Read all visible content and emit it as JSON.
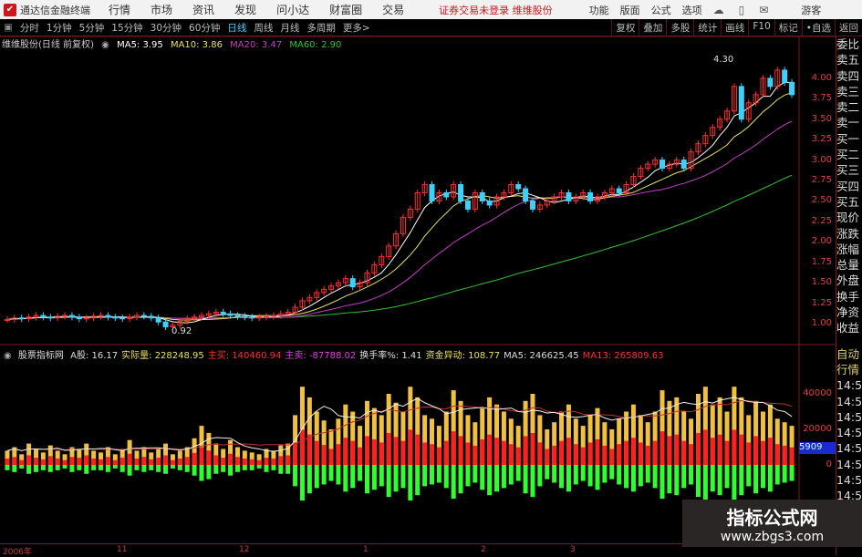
{
  "app": {
    "title": "通达信金融终端",
    "menus": [
      "行情",
      "市场",
      "资讯",
      "发现",
      "问小达",
      "财富圈",
      "交易"
    ],
    "login_status": "证券交易未登录",
    "stock_tag": "维维股份",
    "top_menus": [
      "功能",
      "版面",
      "公式",
      "选项"
    ],
    "user": "游客",
    "icons": [
      "cloud-icon",
      "phone-icon",
      "message-icon"
    ]
  },
  "periods": {
    "items": [
      "分时",
      "1分钟",
      "5分钟",
      "15分钟",
      "30分钟",
      "60分钟",
      "日线",
      "周线",
      "月线",
      "多周期",
      "更多>"
    ],
    "active": "日线"
  },
  "tools": [
    "复权",
    "叠加",
    "多股",
    "统计",
    "画线",
    "F10",
    "标记",
    "•自选",
    "返回"
  ],
  "info": {
    "name": "维维股份(日线 前复权)",
    "ma5": "MA5: 3.95",
    "ma10": "MA10: 3.86",
    "ma20": "MA20: 3.47",
    "ma60": "MA60: 2.90"
  },
  "price_axis": {
    "ticks": [
      "4.00",
      "3.75",
      "3.50",
      "3.25",
      "3.00",
      "2.75",
      "2.50",
      "2.25",
      "2.00",
      "1.75",
      "1.50",
      "1.25",
      "1.00"
    ],
    "high_label": "4.30",
    "low_label": "0.92"
  },
  "indicator": {
    "name": "股票指标网",
    "items": [
      {
        "t": "A股: 16.17",
        "c": "#ddd"
      },
      {
        "t": "实际量: 228248.95",
        "c": "#e8e060"
      },
      {
        "t": "主买: 140460.94",
        "c": "#ff3030"
      },
      {
        "t": "主卖: -87788.02",
        "c": "#e040e0"
      },
      {
        "t": "换手率%: 1.41",
        "c": "#ddd"
      },
      {
        "t": "资金异动: 108.77",
        "c": "#e8e060"
      },
      {
        "t": "MA5: 246625.45",
        "c": "#ddd"
      },
      {
        "t": "MA13: 265809.63",
        "c": "#ff3030"
      }
    ],
    "ticks": [
      "40000",
      "20000",
      "0"
    ],
    "current": "5909"
  },
  "right_panel": {
    "quote_labels": [
      "委比",
      "卖五",
      "卖四",
      "卖三",
      "卖二",
      "卖一",
      "买一",
      "买二",
      "买三",
      "买四",
      "买五",
      "现价",
      "涨跌",
      "涨幅",
      "总量",
      "外盘",
      "换手",
      "净资",
      "收益"
    ],
    "tick_header": [
      "自动",
      "行情"
    ],
    "tick_times": [
      "14:5",
      "14:5",
      "14:5",
      "14:5",
      "14:5",
      "14:5",
      "14:5",
      "14:5"
    ]
  },
  "time_axis": [
    "2006年",
    "11",
    "12",
    "1",
    "2",
    "3"
  ],
  "watermark": {
    "title": "指标公式网",
    "url": "www.zbgs3.com"
  },
  "colors": {
    "up": "#ff3030",
    "down": "#40d0ff",
    "ma5": "#ffffff",
    "ma10": "#e8e060",
    "ma20": "#c040c0",
    "ma60": "#30c030",
    "vol": "#f0c040",
    "buy": "#ff2020",
    "sell": "#30ff30"
  },
  "chart_data": {
    "type": "candlestick",
    "closes": [
      1.05,
      1.07,
      1.06,
      1.08,
      1.1,
      1.08,
      1.07,
      1.09,
      1.1,
      1.08,
      1.06,
      1.07,
      1.09,
      1.1,
      1.08,
      1.07,
      1.06,
      1.08,
      1.1,
      1.09,
      1.07,
      1.02,
      0.96,
      0.98,
      1.03,
      1.06,
      1.08,
      1.1,
      1.12,
      1.14,
      1.12,
      1.1,
      1.09,
      1.08,
      1.07,
      1.08,
      1.09,
      1.1,
      1.12,
      1.14,
      1.2,
      1.28,
      1.32,
      1.38,
      1.42,
      1.46,
      1.5,
      1.55,
      1.45,
      1.5,
      1.62,
      1.72,
      1.82,
      1.95,
      2.1,
      2.3,
      2.4,
      2.6,
      2.7,
      2.5,
      2.6,
      2.55,
      2.7,
      2.5,
      2.4,
      2.6,
      2.5,
      2.45,
      2.55,
      2.6,
      2.7,
      2.65,
      2.5,
      2.4,
      2.45,
      2.5,
      2.55,
      2.6,
      2.5,
      2.55,
      2.6,
      2.5,
      2.55,
      2.6,
      2.65,
      2.6,
      2.7,
      2.8,
      2.9,
      2.95,
      3.0,
      2.9,
      2.95,
      3.0,
      2.9,
      3.1,
      3.2,
      3.3,
      3.4,
      3.5,
      3.6,
      3.9,
      3.5,
      3.7,
      3.8,
      4.0,
      3.9,
      4.1,
      3.95,
      3.8
    ],
    "volume_k": [
      8,
      10,
      6,
      12,
      9,
      7,
      11,
      8,
      6,
      10,
      9,
      12,
      8,
      7,
      10,
      6,
      9,
      14,
      8,
      10,
      7,
      9,
      12,
      6,
      8,
      10,
      15,
      22,
      18,
      12,
      9,
      14,
      10,
      8,
      7,
      6,
      9,
      8,
      11,
      12,
      28,
      44,
      38,
      30,
      25,
      20,
      26,
      34,
      30,
      22,
      36,
      32,
      28,
      40,
      35,
      30,
      44,
      38,
      28,
      26,
      22,
      30,
      42,
      36,
      28,
      24,
      32,
      38,
      34,
      30,
      26,
      22,
      36,
      40,
      28,
      20,
      24,
      30,
      34,
      26,
      22,
      28,
      32,
      24,
      20,
      26,
      30,
      34,
      28,
      24,
      30,
      42,
      36,
      38,
      30,
      26,
      40,
      44,
      34,
      38,
      30,
      44,
      38,
      28,
      36,
      30,
      34,
      26,
      24,
      22
    ],
    "sell_k": [
      3,
      4,
      2,
      5,
      4,
      3,
      4,
      3,
      2,
      4,
      3,
      5,
      3,
      3,
      4,
      2,
      4,
      6,
      3,
      4,
      3,
      4,
      5,
      2,
      3,
      4,
      6,
      9,
      8,
      5,
      4,
      6,
      4,
      3,
      3,
      2,
      4,
      3,
      5,
      5,
      12,
      20,
      16,
      13,
      11,
      9,
      11,
      15,
      13,
      9,
      16,
      14,
      12,
      18,
      15,
      13,
      20,
      17,
      12,
      11,
      10,
      13,
      19,
      16,
      12,
      10,
      14,
      17,
      15,
      13,
      11,
      9,
      16,
      18,
      12,
      8,
      10,
      13,
      15,
      11,
      9,
      12,
      14,
      10,
      8,
      11,
      13,
      15,
      12,
      10,
      13,
      19,
      16,
      17,
      13,
      11,
      18,
      20,
      15,
      17,
      13,
      20,
      17,
      12,
      16,
      13,
      15,
      11,
      10,
      9
    ]
  }
}
